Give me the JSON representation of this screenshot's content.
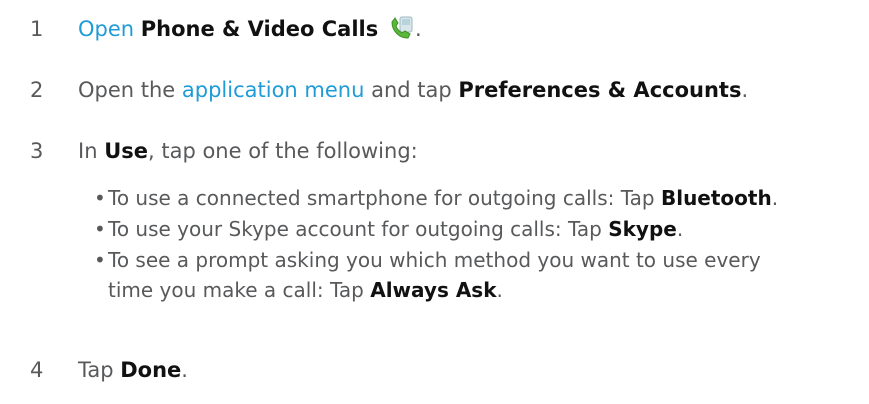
{
  "steps": [
    {
      "number": "1",
      "link": "Open",
      "bold": "Phone & Video Calls",
      "end": "."
    },
    {
      "number": "2",
      "pre": "Open the ",
      "link": "application menu",
      "mid": " and tap ",
      "bold": "Preferences & Accounts",
      "end": "."
    },
    {
      "number": "3",
      "pre": "In ",
      "bold": "Use",
      "end": ", tap one of the following:"
    },
    {
      "number": "4",
      "pre": "Tap ",
      "bold": "Done",
      "end": "."
    }
  ],
  "bullets": [
    {
      "pre": "To use a connected smartphone for outgoing calls: Tap ",
      "bold": "Bluetooth",
      "end": "."
    },
    {
      "pre": "To use your Skype account for outgoing calls: Tap ",
      "bold": "Skype",
      "end": "."
    },
    {
      "line1": "To see a prompt asking you which method you want to use every",
      "pre": "time you make a call: Tap ",
      "bold": "Always Ask",
      "end": "."
    }
  ],
  "bullet_glyph": "•",
  "icons": {
    "phone_app": "phone-video-calls-icon"
  },
  "colors": {
    "text": "#58595b",
    "link": "#1f9bd7",
    "bold": "#111111"
  }
}
